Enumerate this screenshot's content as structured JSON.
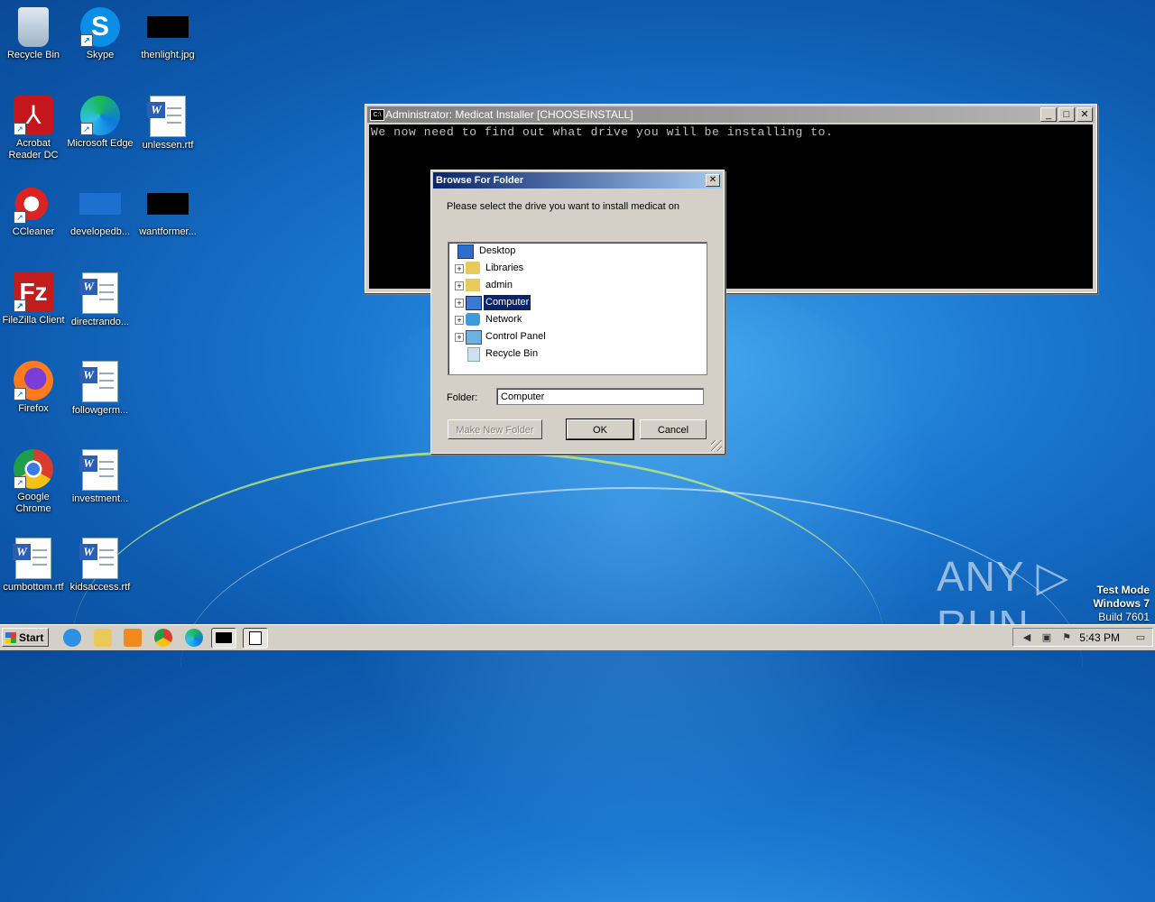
{
  "desktop": {
    "icons": [
      {
        "label": "Recycle Bin",
        "icon": "recycle-bin-icon"
      },
      {
        "label": "Skype",
        "icon": "skype-icon"
      },
      {
        "label": "thenlight.jpg",
        "icon": "image-file-icon"
      },
      {
        "label": "Acrobat Reader DC",
        "icon": "acrobat-icon"
      },
      {
        "label": "Microsoft Edge",
        "icon": "edge-icon"
      },
      {
        "label": "unlessen.rtf",
        "icon": "word-doc-icon"
      },
      {
        "label": "CCleaner",
        "icon": "ccleaner-icon"
      },
      {
        "label": "developedb...",
        "icon": "file-icon"
      },
      {
        "label": "wantformer...",
        "icon": "image-file-icon"
      },
      {
        "label": "FileZilla Client",
        "icon": "filezilla-icon"
      },
      {
        "label": "directrando...",
        "icon": "word-doc-icon"
      },
      {
        "label": "Firefox",
        "icon": "firefox-icon"
      },
      {
        "label": "followgerm...",
        "icon": "word-doc-icon"
      },
      {
        "label": "Google Chrome",
        "icon": "chrome-icon"
      },
      {
        "label": "investment...",
        "icon": "word-doc-icon"
      },
      {
        "label": "cumbottom.rtf",
        "icon": "word-doc-icon"
      },
      {
        "label": "kidsaccess.rtf",
        "icon": "word-doc-icon"
      }
    ]
  },
  "console": {
    "title": "Administrator:  Medicat Installer [CHOOSEINSTALL]",
    "output": "We now need to find out what drive you will be installing to.",
    "controls": {
      "minimize": "_",
      "maximize": "□",
      "close": "✕"
    }
  },
  "dialog": {
    "title": "Browse For Folder",
    "close": "✕",
    "prompt": "Please select the drive you want to install medicat on",
    "tree": [
      {
        "label": "Desktop",
        "icon": "desktop-icon",
        "expandable": false,
        "selected": false
      },
      {
        "label": "Libraries",
        "icon": "libraries-folder-icon",
        "expandable": true,
        "selected": false
      },
      {
        "label": "admin",
        "icon": "user-folder-icon",
        "expandable": true,
        "selected": false
      },
      {
        "label": "Computer",
        "icon": "computer-icon",
        "expandable": true,
        "selected": true
      },
      {
        "label": "Network",
        "icon": "network-icon",
        "expandable": true,
        "selected": false
      },
      {
        "label": "Control Panel",
        "icon": "control-panel-icon",
        "expandable": true,
        "selected": false
      },
      {
        "label": "Recycle Bin",
        "icon": "recycle-bin-icon",
        "expandable": false,
        "selected": false
      }
    ],
    "expander": "+",
    "folder_label": "Folder:",
    "folder_value": "Computer",
    "buttons": {
      "new_folder": "Make New Folder",
      "ok": "OK",
      "cancel": "Cancel"
    }
  },
  "watermark": {
    "brand": "ANY ▷ RUN",
    "mode": "Test Mode",
    "os": "Windows 7",
    "build": "Build 7601"
  },
  "taskbar": {
    "start": "Start",
    "clock": "5:43 PM",
    "pinned": [
      "ie-icon",
      "explorer-icon",
      "media-player-icon",
      "chrome-icon",
      "edge-icon",
      "cmd-icon",
      "installer-window-icon"
    ]
  }
}
